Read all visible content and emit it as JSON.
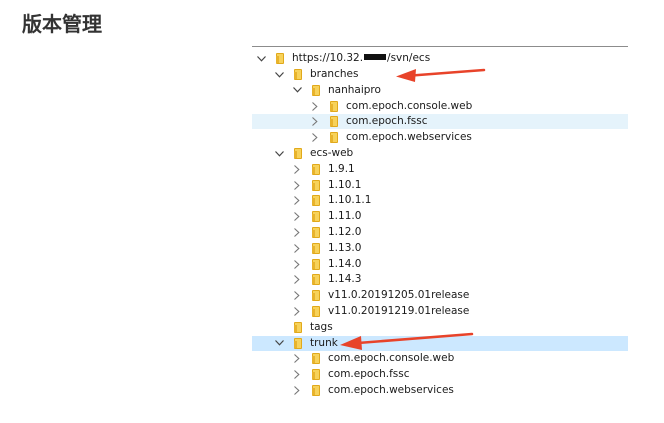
{
  "page": {
    "title": "版本管理"
  },
  "tree": {
    "root": {
      "label_prefix": "https://10.32.",
      "label_suffix": "/svn/ecs"
    },
    "items": [
      {
        "label": "branches",
        "depth": 1,
        "expander": "expanded"
      },
      {
        "label": "nanhaipro",
        "depth": 2,
        "expander": "expanded"
      },
      {
        "label": "com.epoch.console.web",
        "depth": 3,
        "expander": "collapsed"
      },
      {
        "label": "com.epoch.fssc",
        "depth": 3,
        "expander": "collapsed",
        "state": "hover"
      },
      {
        "label": "com.epoch.webservices",
        "depth": 3,
        "expander": "collapsed"
      },
      {
        "label": "ecs-web",
        "depth": 1,
        "expander": "expanded"
      },
      {
        "label": "1.9.1",
        "depth": 2,
        "expander": "collapsed"
      },
      {
        "label": "1.10.1",
        "depth": 2,
        "expander": "collapsed"
      },
      {
        "label": "1.10.1.1",
        "depth": 2,
        "expander": "collapsed"
      },
      {
        "label": "1.11.0",
        "depth": 2,
        "expander": "collapsed"
      },
      {
        "label": "1.12.0",
        "depth": 2,
        "expander": "collapsed"
      },
      {
        "label": "1.13.0",
        "depth": 2,
        "expander": "collapsed"
      },
      {
        "label": "1.14.0",
        "depth": 2,
        "expander": "collapsed"
      },
      {
        "label": "1.14.3",
        "depth": 2,
        "expander": "collapsed"
      },
      {
        "label": "v11.0.20191205.01release",
        "depth": 2,
        "expander": "collapsed"
      },
      {
        "label": "v11.0.20191219.01release",
        "depth": 2,
        "expander": "collapsed"
      },
      {
        "label": "tags",
        "depth": 1,
        "expander": "none"
      },
      {
        "label": "trunk",
        "depth": 1,
        "expander": "expanded",
        "state": "selected"
      },
      {
        "label": "com.epoch.console.web",
        "depth": 2,
        "expander": "collapsed"
      },
      {
        "label": "com.epoch.fssc",
        "depth": 2,
        "expander": "collapsed"
      },
      {
        "label": "com.epoch.webservices",
        "depth": 2,
        "expander": "collapsed"
      }
    ]
  },
  "colors": {
    "selected_row": "#cce8ff",
    "hover_row": "#e5f3fb",
    "annotation_arrow": "#e8432a",
    "folder": "#f7d25a"
  },
  "icons": {
    "expanded": "chevron-down-icon",
    "collapsed": "chevron-right-icon",
    "folder": "folder-icon"
  }
}
